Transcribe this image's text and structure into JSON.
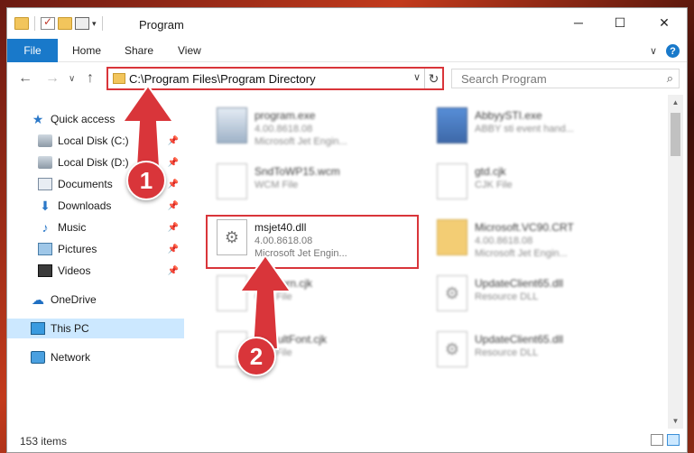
{
  "window": {
    "title": "Program"
  },
  "ribbon": {
    "tabs": [
      "File",
      "Home",
      "Share",
      "View"
    ]
  },
  "window_controls": {
    "minimize": "─",
    "maximize": "☐",
    "close": "✕",
    "expand": "∨"
  },
  "nav": {
    "address": "C:\\Program Files\\Program Directory",
    "search_placeholder": "Search Program",
    "back": "←",
    "forward": "→",
    "recent": "∨",
    "up": "↑",
    "refresh": "↻",
    "search_glyph": "⌕"
  },
  "sidebar": {
    "items": [
      {
        "label": "Quick access",
        "icon": "star-icon",
        "pinned": false
      },
      {
        "label": "Local Disk (C:)",
        "icon": "disk-icon",
        "pinned": true
      },
      {
        "label": "Local Disk (D:)",
        "icon": "disk-icon",
        "pinned": true
      },
      {
        "label": "Documents",
        "icon": "documents-icon",
        "pinned": true
      },
      {
        "label": "Downloads",
        "icon": "downloads-icon",
        "pinned": true
      },
      {
        "label": "Music",
        "icon": "music-icon",
        "pinned": true
      },
      {
        "label": "Pictures",
        "icon": "pictures-icon",
        "pinned": true
      },
      {
        "label": "Videos",
        "icon": "videos-icon",
        "pinned": true
      },
      {
        "label": "OneDrive",
        "icon": "onedrive-icon",
        "pinned": false
      },
      {
        "label": "This PC",
        "icon": "this-pc-icon",
        "pinned": false,
        "selected": true
      },
      {
        "label": "Network",
        "icon": "network-icon",
        "pinned": false
      }
    ]
  },
  "files": [
    {
      "name": "program.exe",
      "line2": "4.00.8618.08",
      "line3": "Microsoft Jet Engin...",
      "icon": "exe-icon"
    },
    {
      "name": "AbbyySTI.exe",
      "line2": "ABBY sti event hand...",
      "line3": "",
      "icon": "app-icon"
    },
    {
      "name": "SndToWP15.wcm",
      "line2": "WCM File",
      "line3": "",
      "icon": "document-icon"
    },
    {
      "name": "gtd.cjk",
      "line2": "CJK File",
      "line3": "",
      "icon": "document-icon"
    },
    {
      "name": "msjet40.dll",
      "line2": "4.00.8618.08",
      "line3": "Microsoft Jet Engin...",
      "icon": "dll-gear-icon"
    },
    {
      "name": "Microsoft.VC90.CRT",
      "line2": "4.00.8618.08",
      "line3": "Microsoft Jet Engin...",
      "icon": "folder-icon"
    },
    {
      "name": "EditKorn.cjk",
      "line2": "CJK File",
      "line3": "",
      "icon": "document-icon"
    },
    {
      "name": "UpdateClient65.dll",
      "line2": "Resource DLL",
      "line3": "",
      "icon": "dll-gear-icon"
    },
    {
      "name": "DefaultFont.cjk",
      "line2": "CJK File",
      "line3": "",
      "icon": "document-icon"
    },
    {
      "name": "UpdateClient65.dll",
      "line2": "Resource DLL",
      "line3": "",
      "icon": "dll-gear-icon"
    }
  ],
  "status": {
    "items": "153 items"
  },
  "annotations": {
    "step1": "1",
    "step2": "2"
  },
  "colors": {
    "accent": "#1979ca",
    "highlight": "#d9353a",
    "selected": "#cce8ff"
  }
}
